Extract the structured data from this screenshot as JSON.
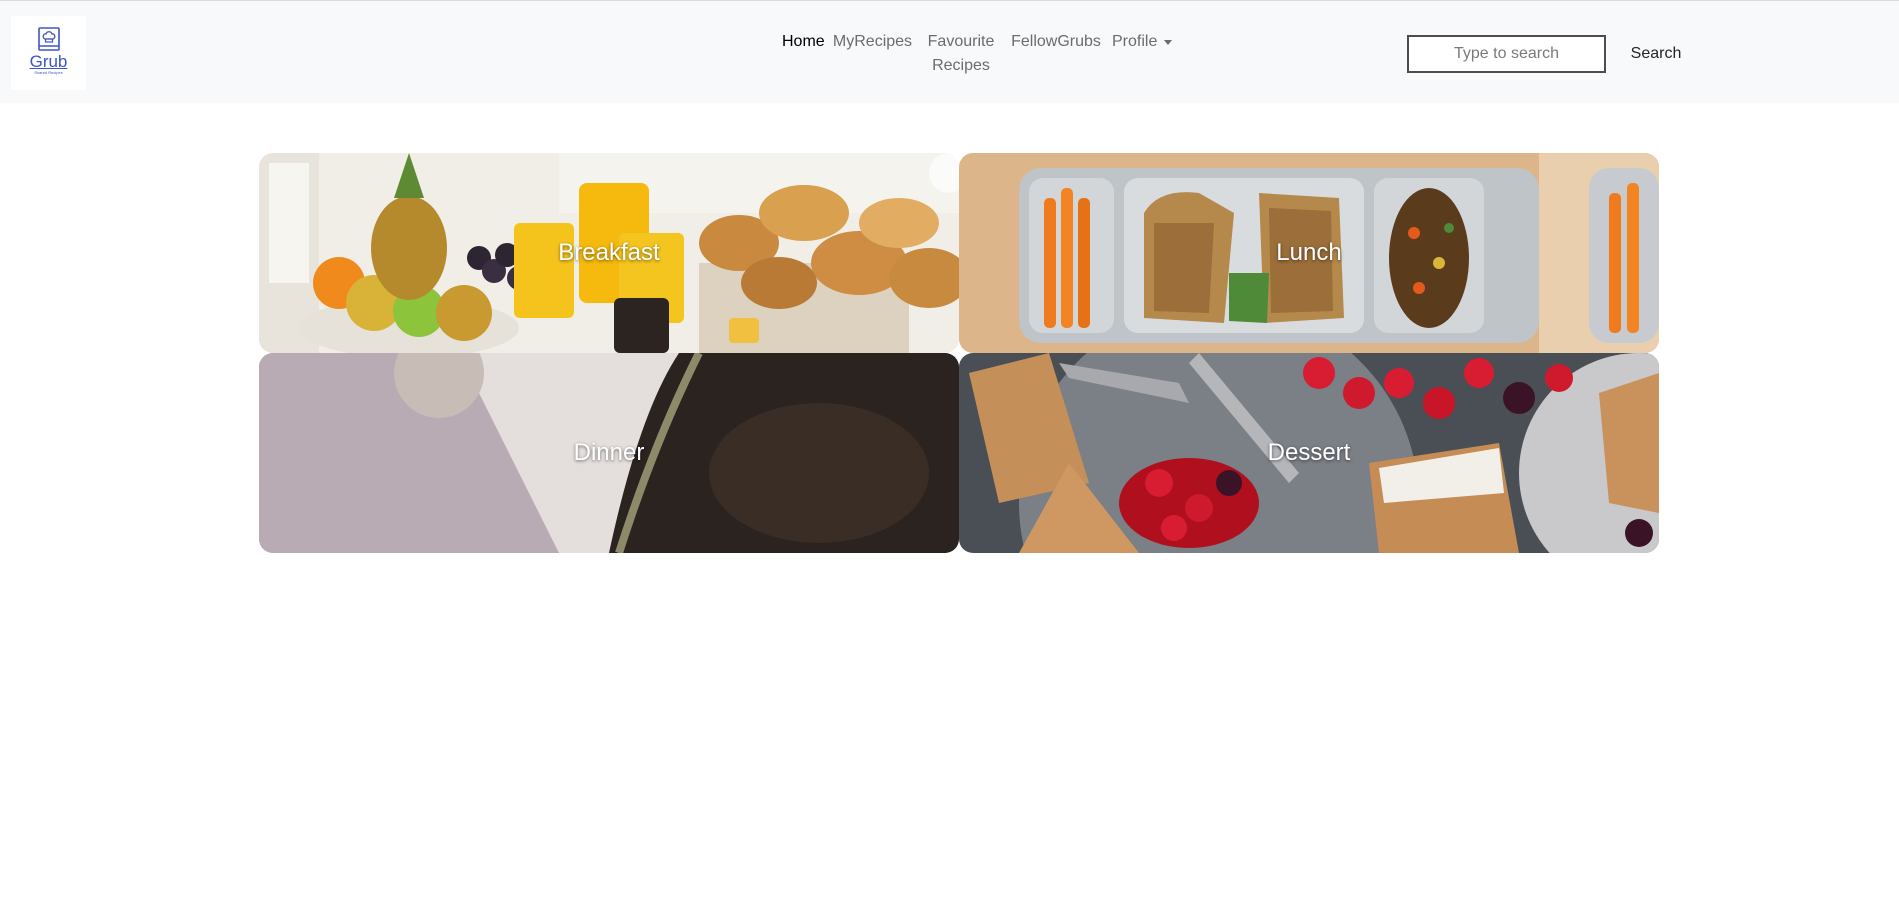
{
  "logo": {
    "word": "Grub",
    "tagline": "Shared Recipes"
  },
  "nav": {
    "home": "Home",
    "myrecipes": "MyRecipes",
    "favourite_line1": "Favourite",
    "favourite_line2": "Recipes",
    "fellowgrubs": "FellowGrubs",
    "profile": "Profile"
  },
  "search": {
    "placeholder": "Type to search",
    "button": "Search"
  },
  "categories": [
    {
      "label": "Breakfast"
    },
    {
      "label": "Lunch"
    },
    {
      "label": "Dinner"
    },
    {
      "label": "Dessert"
    }
  ],
  "colors": {
    "logo_blue": "#3f55c6",
    "nav_bg": "#f8f9fa",
    "active_link": "#000000",
    "link": "#6c6c6c"
  }
}
